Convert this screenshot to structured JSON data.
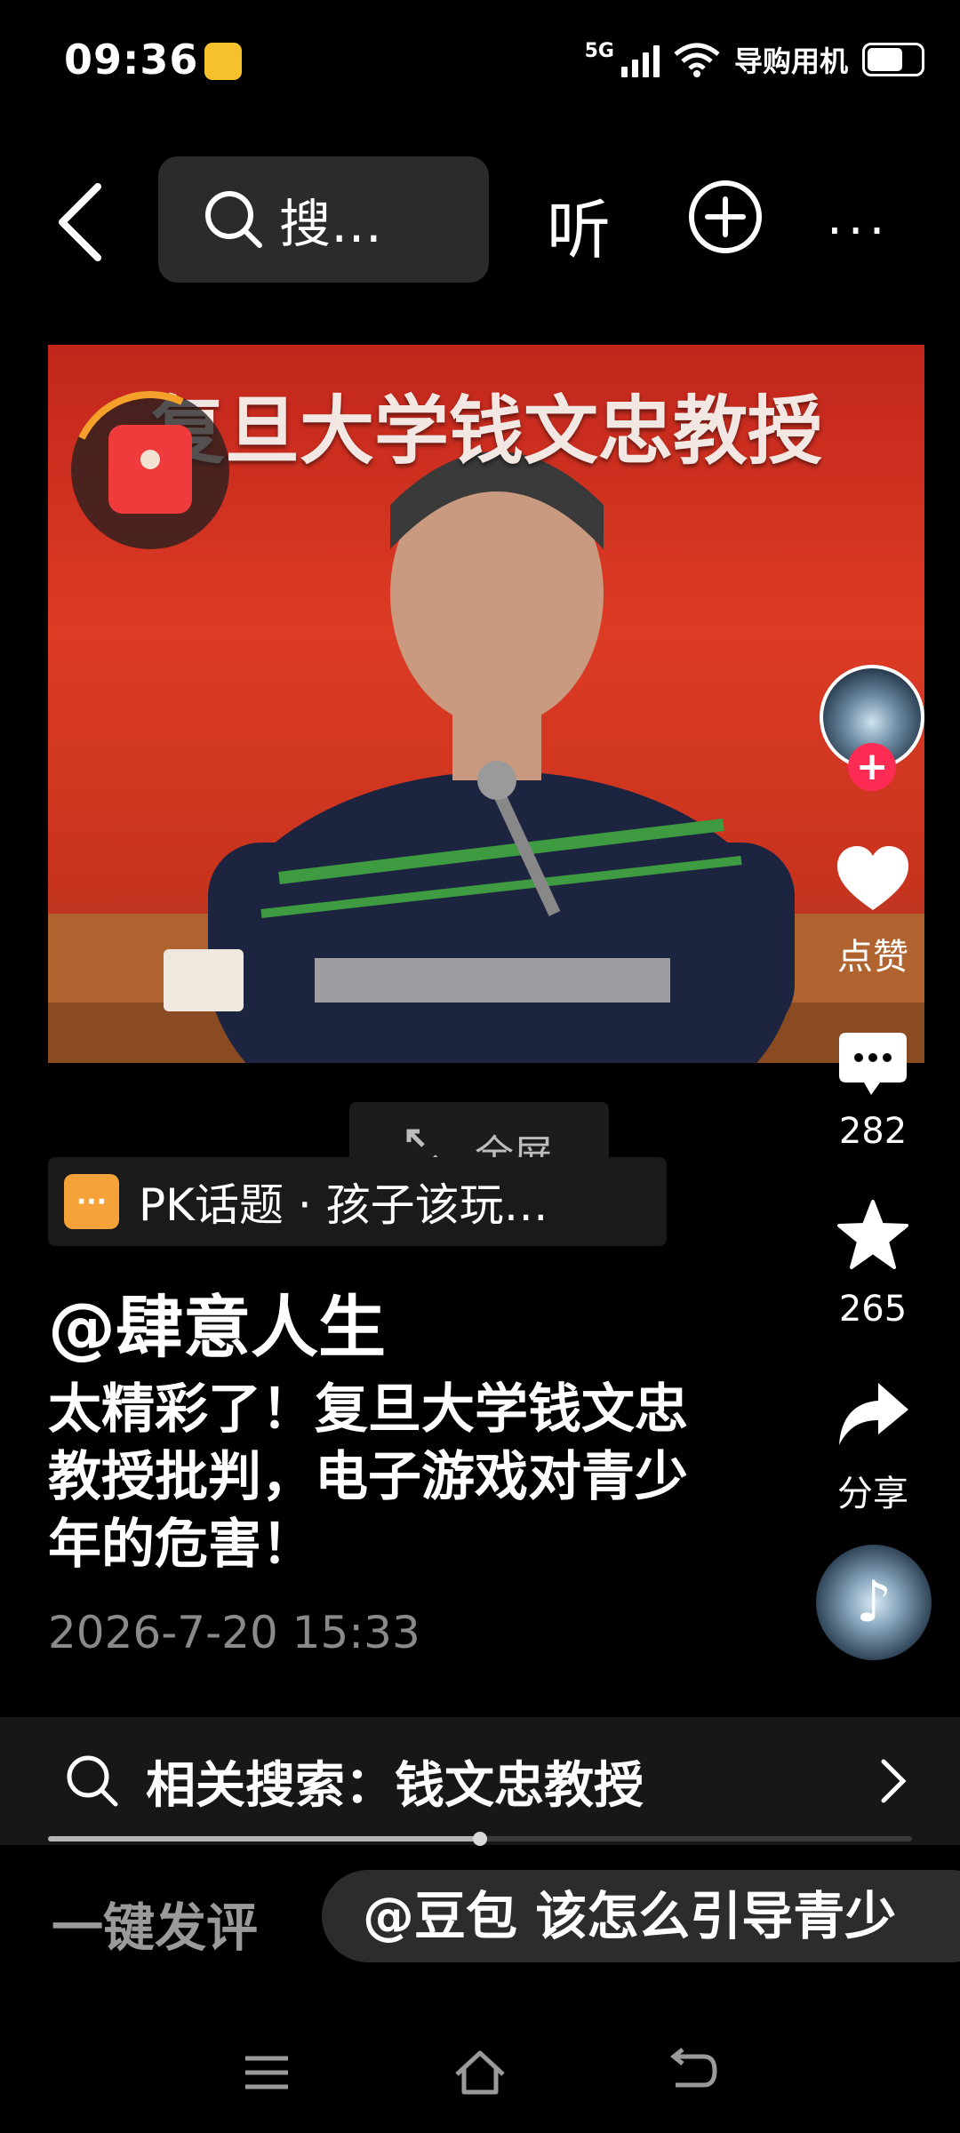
{
  "status_bar": {
    "time": "09:36",
    "network": "5G",
    "carrier": "导购用机",
    "battery_level": 0.7
  },
  "top_bar": {
    "search_text": "搜…",
    "listen_label": "听",
    "more_label": "···"
  },
  "video": {
    "overlay_title": "复旦大学钱文忠教授",
    "fullscreen_label": "全屏"
  },
  "right_rail": {
    "follow_label": "+",
    "like_label": "点赞",
    "comment_count": "282",
    "favorite_count": "265",
    "share_label": "分享",
    "music_symbol": "♪"
  },
  "topic": {
    "icon_text": "···",
    "label": "PK话题 · 孩子该玩…"
  },
  "post": {
    "author": "@肆意人生",
    "caption": "太精彩了！复旦大学钱文忠教授批判，电子游戏对青少年的危害！",
    "date": "2026-7-20 15:33"
  },
  "related_search": {
    "label": "相关搜索：钱文忠教授"
  },
  "playback": {
    "progress": 0.5
  },
  "comment_bar": {
    "quick_comment_label": "一键发评",
    "ai_prompt": "@豆包 该怎么引导青少"
  },
  "colors": {
    "background": "#000000",
    "accent_red": "#fe2c55",
    "topic_orange": "#f5a23a",
    "status_yellow": "#f6c12b"
  },
  "icons": [
    "back-arrow-icon",
    "search-icon",
    "plus-circle-icon",
    "heart-icon",
    "comment-icon",
    "star-icon",
    "share-icon",
    "music-note-icon",
    "expand-icon",
    "chevron-right-icon",
    "menu-icon",
    "home-icon",
    "return-icon"
  ]
}
